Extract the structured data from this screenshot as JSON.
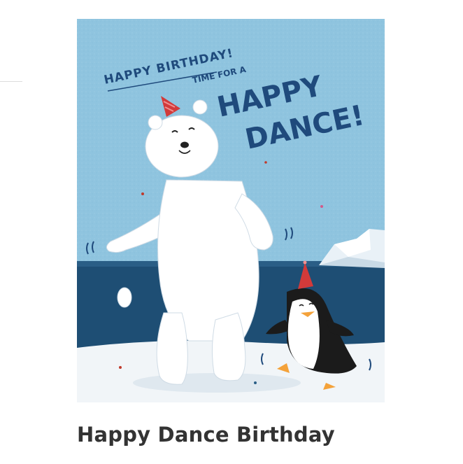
{
  "product": {
    "title": "Happy Dance Birthday",
    "card_text": {
      "line1": "HAPPY BIRTHDAY!",
      "line2": "TIME FOR A",
      "line3": "HAPPY",
      "line4": "DANCE!"
    }
  },
  "colors": {
    "sky": "#8fc4df",
    "water": "#1e4e74",
    "text": "#1f4a7c",
    "hat": "#d23a3a",
    "title": "#333333"
  }
}
